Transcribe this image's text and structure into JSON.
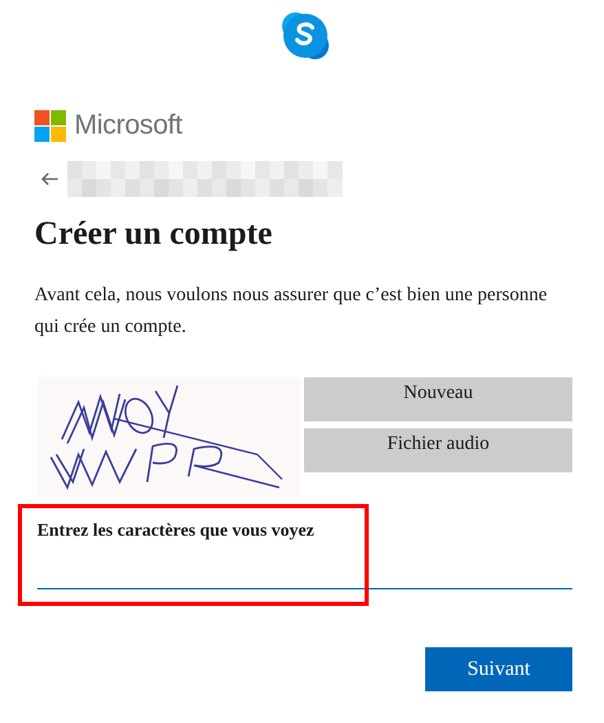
{
  "brand": {
    "name": "Microsoft"
  },
  "title": "Créer un compte",
  "description": "Avant cela, nous voulons nous assurer que c’est bien une personne qui crée un compte.",
  "captcha": {
    "kind": "picture",
    "buttons": [
      "Nouveau",
      "Fichier audio"
    ]
  },
  "field": {
    "label": "Entrez les caractères que vous voyez",
    "highlighted": true
  },
  "next_button": "Suivant"
}
